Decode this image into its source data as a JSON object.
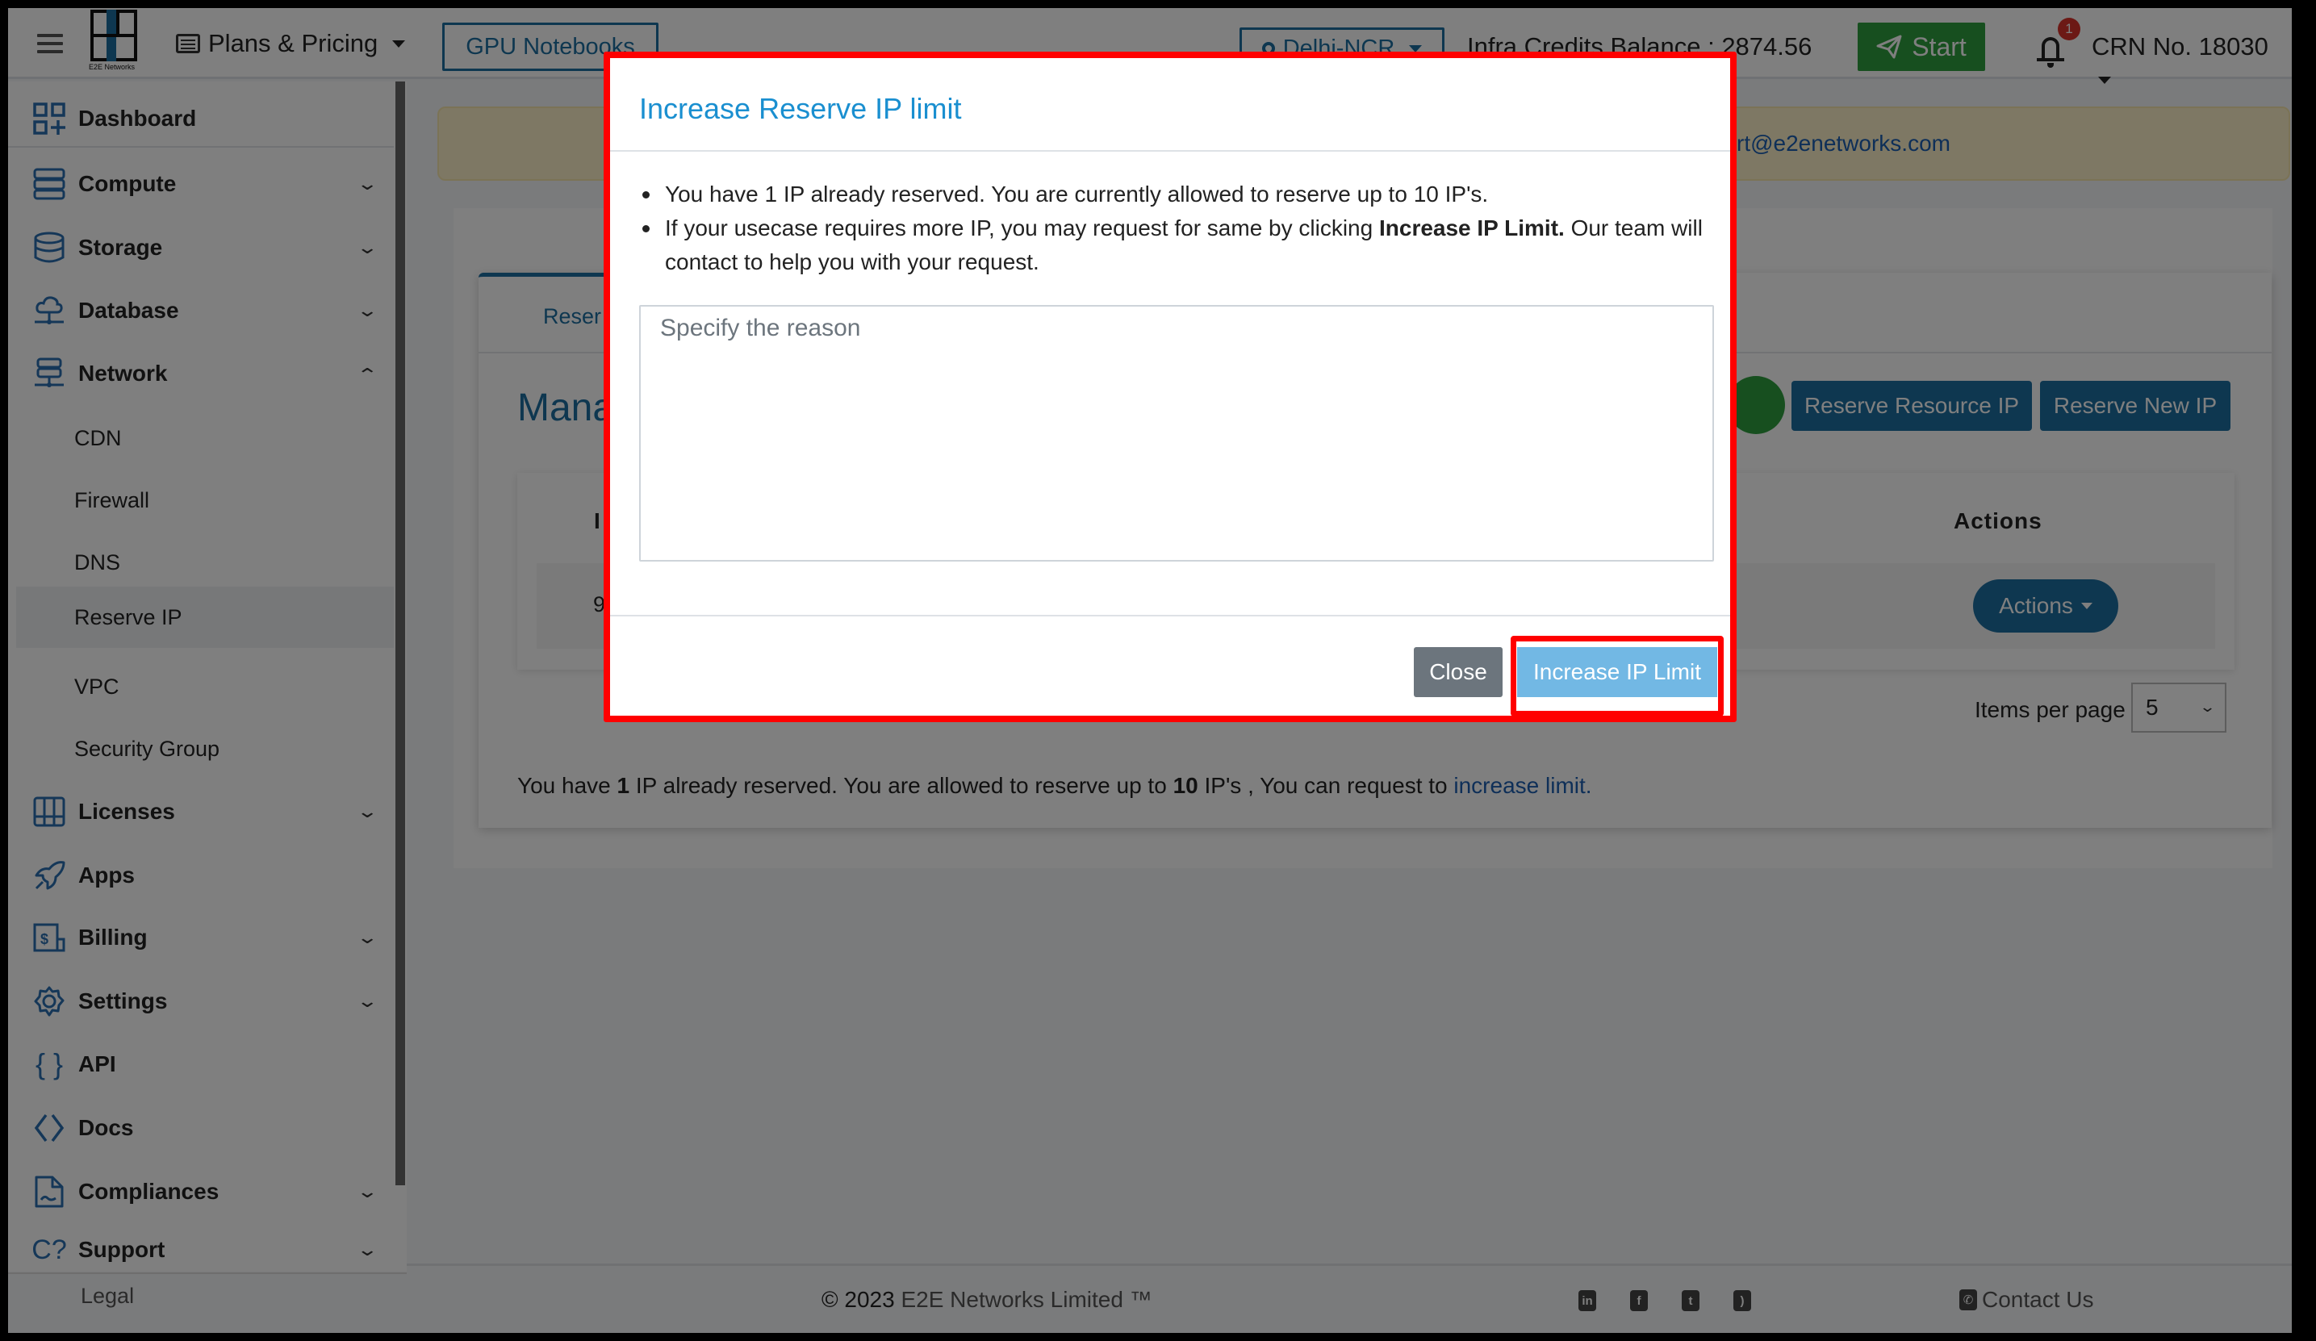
{
  "header": {
    "logo_text": "E2E Networks",
    "plans_label": "Plans & Pricing",
    "gpu_label": "GPU Notebooks",
    "location_label": "Delhi-NCR",
    "credits_label": "Infra Credits Balance : 2874.56",
    "start_label": "Start",
    "notification_count": "1",
    "crn_label": "CRN No. 18030"
  },
  "sidebar": {
    "items": [
      {
        "label": "Dashboard",
        "icon": "dashboard-icon"
      },
      {
        "label": "Compute",
        "icon": "server-icon",
        "expandable": true
      },
      {
        "label": "Storage",
        "icon": "database-icon",
        "expandable": true
      },
      {
        "label": "Database",
        "icon": "cloud-network-icon",
        "expandable": true
      },
      {
        "label": "Network",
        "icon": "network-icon",
        "expanded": true
      },
      {
        "label": "Licenses",
        "icon": "licenses-icon",
        "expandable": true
      },
      {
        "label": "Apps",
        "icon": "rocket-icon"
      },
      {
        "label": "Billing",
        "icon": "billing-icon",
        "expandable": true
      },
      {
        "label": "Settings",
        "icon": "gear-icon",
        "expandable": true
      },
      {
        "label": "API",
        "icon": "braces-icon"
      },
      {
        "label": "Docs",
        "icon": "code-icon"
      },
      {
        "label": "Compliances",
        "icon": "document-icon",
        "expandable": true
      },
      {
        "label": "Support",
        "icon": "support-icon",
        "expandable": true
      }
    ],
    "network_sub": [
      "CDN",
      "Firewall",
      "DNS",
      "Reserve IP",
      "VPC",
      "Security Group"
    ],
    "active_sub": "Reserve IP",
    "legal_label": "Legal"
  },
  "notice": {
    "email_fragment": "rt@e2enetworks.com"
  },
  "page": {
    "tab_label": "Reser",
    "title_fragment": "Mana",
    "refresh_icon_fragment": "c",
    "reserve_resource_label": "Reserve Resource IP",
    "reserve_new_label": "Reserve New IP",
    "table": {
      "first_col_fragment": "I",
      "actions_header": "Actions",
      "row_first_fragment": "9",
      "row_action_label": "Actions"
    },
    "items_per_page_label": "Items per page",
    "items_per_page_value": "5",
    "info": {
      "p1": "You have ",
      "count": "1",
      "p2": " IP already reserved. You are allowed to reserve up to ",
      "limit": "10",
      "p3": " IP's , You can request to ",
      "link": "increase limit."
    }
  },
  "footer": {
    "copyright_year": "© 2023",
    "copyright_rest": " E2E Networks Limited ™",
    "social": [
      "linkedin-icon",
      "facebook-icon",
      "twitter-icon",
      "rss-icon"
    ],
    "contact_label": "Contact Us"
  },
  "modal": {
    "title": "Increase Reserve IP limit",
    "bullet1": "You have 1 IP already reserved. You are currently allowed to reserve up to 10 IP's.",
    "bullet2_pre": "If your usecase requires more IP, you may request for same by clicking ",
    "bullet2_bold": "Increase IP Limit.",
    "bullet2_post": " Our team will contact to help you with your request.",
    "reason_placeholder": "Specify the reason",
    "reason_value": "",
    "close_label": "Close",
    "increase_label": "Increase IP Limit"
  },
  "colors": {
    "brand_blue": "#1d6ea0",
    "start_green": "#2e9e3e",
    "modal_title": "#1a8fd0",
    "highlight_red": "#ff0000",
    "increase_btn": "#72b8e4",
    "close_btn": "#6c757d"
  }
}
